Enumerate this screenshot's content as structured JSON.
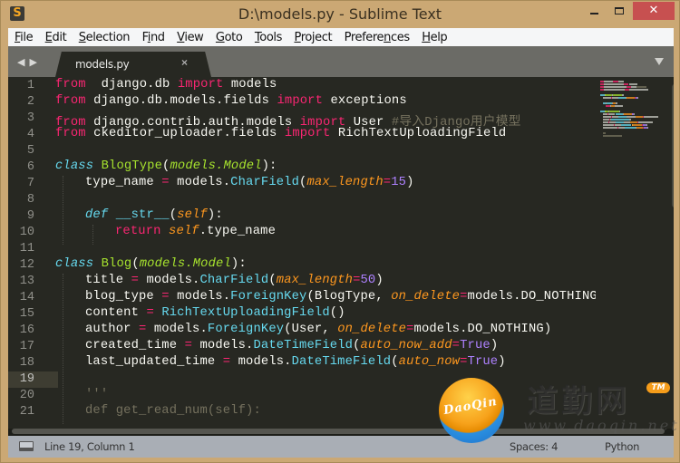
{
  "window": {
    "title": "D:\\models.py - Sublime Text",
    "app_icon": "sublime-text-icon",
    "controls": {
      "minimize": "minimize-icon",
      "maximize": "maximize-icon",
      "close_label": "✕"
    }
  },
  "menu": [
    {
      "pre": "",
      "u": "F",
      "post": "ile"
    },
    {
      "pre": "",
      "u": "E",
      "post": "dit"
    },
    {
      "pre": "",
      "u": "S",
      "post": "election"
    },
    {
      "pre": "F",
      "u": "i",
      "post": "nd"
    },
    {
      "pre": "",
      "u": "V",
      "post": "iew"
    },
    {
      "pre": "",
      "u": "G",
      "post": "oto"
    },
    {
      "pre": "",
      "u": "T",
      "post": "ools"
    },
    {
      "pre": "",
      "u": "P",
      "post": "roject"
    },
    {
      "pre": "Prefere",
      "u": "n",
      "post": "ces"
    },
    {
      "pre": "",
      "u": "H",
      "post": "elp"
    }
  ],
  "tabs": {
    "nav_label": "◀ ▶",
    "items": [
      {
        "label": "models.py",
        "close": "×",
        "active": true
      }
    ],
    "dropdown_icon": "chevron-down-icon"
  },
  "editor": {
    "active_line": 19,
    "lines": [
      {
        "n": 1,
        "indent": 0,
        "tokens": [
          [
            "kw",
            "from"
          ],
          [
            "",
            "  django.db "
          ],
          [
            "kw",
            "import"
          ],
          [
            "",
            " models"
          ]
        ]
      },
      {
        "n": 2,
        "indent": 0,
        "tokens": [
          [
            "kw",
            "from"
          ],
          [
            "",
            " django.db.models.fields "
          ],
          [
            "kw",
            "import"
          ],
          [
            "",
            " exceptions"
          ]
        ]
      },
      {
        "n": 3,
        "indent": 0,
        "tokens": [
          [
            "kw",
            "from"
          ],
          [
            "",
            " django.contrib.auth.models "
          ],
          [
            "kw",
            "import"
          ],
          [
            "",
            " User "
          ],
          [
            "cm",
            "#导入Django用户模型"
          ]
        ]
      },
      {
        "n": 4,
        "indent": 0,
        "tokens": [
          [
            "kw",
            "from"
          ],
          [
            "",
            " ckeditor_uploader.fields "
          ],
          [
            "kw",
            "import"
          ],
          [
            "",
            " RichTextUploadingField"
          ]
        ]
      },
      {
        "n": 5,
        "indent": 0,
        "tokens": []
      },
      {
        "n": 6,
        "indent": 0,
        "tokens": [
          [
            "st",
            "class"
          ],
          [
            "",
            " "
          ],
          [
            "cls",
            "BlogType"
          ],
          [
            "",
            "("
          ],
          [
            "inh",
            "models.Model"
          ],
          [
            "",
            "):"
          ]
        ]
      },
      {
        "n": 7,
        "indent": 1,
        "tokens": [
          [
            "",
            "type_name "
          ],
          [
            "kw",
            "="
          ],
          [
            "",
            " models."
          ],
          [
            "fn",
            "CharField"
          ],
          [
            "",
            "("
          ],
          [
            "arg",
            "max_length"
          ],
          [
            "kw",
            "="
          ],
          [
            "num",
            "15"
          ],
          [
            "",
            ")"
          ]
        ]
      },
      {
        "n": 8,
        "indent": 0,
        "tokens": []
      },
      {
        "n": 9,
        "indent": 1,
        "tokens": [
          [
            "st",
            "def"
          ],
          [
            "",
            " "
          ],
          [
            "fn",
            "__str__"
          ],
          [
            "",
            "("
          ],
          [
            "arg",
            "self"
          ],
          [
            "",
            "):"
          ]
        ]
      },
      {
        "n": 10,
        "indent": 2,
        "tokens": [
          [
            "kw",
            "return"
          ],
          [
            "",
            " "
          ],
          [
            "arg",
            "self"
          ],
          [
            "",
            ".type_name"
          ]
        ]
      },
      {
        "n": 11,
        "indent": 0,
        "tokens": []
      },
      {
        "n": 12,
        "indent": 0,
        "tokens": [
          [
            "st",
            "class"
          ],
          [
            "",
            " "
          ],
          [
            "cls",
            "Blog"
          ],
          [
            "",
            "("
          ],
          [
            "inh",
            "models.Model"
          ],
          [
            "",
            "):"
          ]
        ]
      },
      {
        "n": 13,
        "indent": 1,
        "tokens": [
          [
            "",
            "title "
          ],
          [
            "kw",
            "="
          ],
          [
            "",
            " models."
          ],
          [
            "fn",
            "CharField"
          ],
          [
            "",
            "("
          ],
          [
            "arg",
            "max_length"
          ],
          [
            "kw",
            "="
          ],
          [
            "num",
            "50"
          ],
          [
            "",
            ")"
          ]
        ]
      },
      {
        "n": 14,
        "indent": 1,
        "tokens": [
          [
            "",
            "blog_type "
          ],
          [
            "kw",
            "="
          ],
          [
            "",
            " models."
          ],
          [
            "fn",
            "ForeignKey"
          ],
          [
            "",
            "(BlogType, "
          ],
          [
            "arg",
            "on_delete"
          ],
          [
            "kw",
            "="
          ],
          [
            "",
            "models.DO_NOTHING)"
          ]
        ]
      },
      {
        "n": 15,
        "indent": 1,
        "tokens": [
          [
            "",
            "content "
          ],
          [
            "kw",
            "="
          ],
          [
            "",
            " "
          ],
          [
            "fn",
            "RichTextUploadingField"
          ],
          [
            "",
            "()"
          ]
        ]
      },
      {
        "n": 16,
        "indent": 1,
        "tokens": [
          [
            "",
            "author "
          ],
          [
            "kw",
            "="
          ],
          [
            "",
            " models."
          ],
          [
            "fn",
            "ForeignKey"
          ],
          [
            "",
            "(User, "
          ],
          [
            "arg",
            "on_delete"
          ],
          [
            "kw",
            "="
          ],
          [
            "",
            "models.DO_NOTHING)"
          ]
        ]
      },
      {
        "n": 17,
        "indent": 1,
        "tokens": [
          [
            "",
            "created_time "
          ],
          [
            "kw",
            "="
          ],
          [
            "",
            " models."
          ],
          [
            "fn",
            "DateTimeField"
          ],
          [
            "",
            "("
          ],
          [
            "arg",
            "auto_now_add"
          ],
          [
            "kw",
            "="
          ],
          [
            "num",
            "True"
          ],
          [
            "",
            ")"
          ]
        ]
      },
      {
        "n": 18,
        "indent": 1,
        "tokens": [
          [
            "",
            "last_updated_time "
          ],
          [
            "kw",
            "="
          ],
          [
            "",
            " models."
          ],
          [
            "fn",
            "DateTimeField"
          ],
          [
            "",
            "("
          ],
          [
            "arg",
            "auto_now"
          ],
          [
            "kw",
            "="
          ],
          [
            "num",
            "True"
          ],
          [
            "",
            ")"
          ]
        ]
      },
      {
        "n": 19,
        "indent": 0,
        "tokens": []
      },
      {
        "n": 20,
        "indent": 1,
        "tokens": [
          [
            "dim",
            "'''"
          ]
        ]
      },
      {
        "n": 21,
        "indent": 1,
        "tokens": [
          [
            "dim",
            "def get_read_num(self):"
          ]
        ]
      }
    ]
  },
  "statusbar": {
    "panel_icon": "panel-toggle-icon",
    "position": "Line 19, Column 1",
    "indentation": "Spaces: 4",
    "syntax": "Python"
  },
  "watermark": {
    "ball_text": "DaoQin",
    "chinese": "道勤网",
    "url": "www.daoqin.net",
    "tm": "TM"
  },
  "colors": {
    "keyword": "#f92672",
    "storage": "#66d9ef",
    "class_name": "#a6e22e",
    "argument": "#fd971f",
    "number": "#ae81ff",
    "comment": "#75715e",
    "background": "#272822",
    "close_button": "#c75050"
  }
}
